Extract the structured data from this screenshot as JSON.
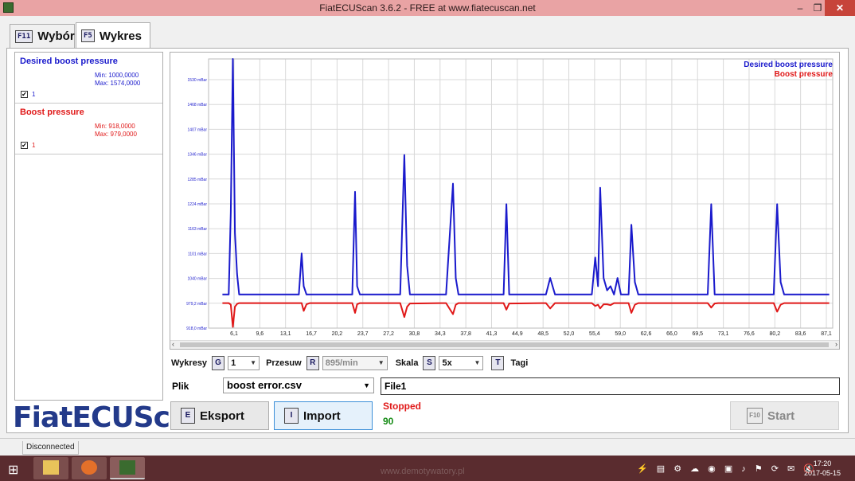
{
  "window": {
    "title": "FiatECUScan 3.6.2 - FREE at www.fiatecuscan.net",
    "minimize": "–",
    "maximize": "❐",
    "close": "✕"
  },
  "tabs": [
    {
      "key": "F11",
      "label": "Wybór"
    },
    {
      "key": "F5",
      "label": "Wykres"
    }
  ],
  "params": [
    {
      "name": "Desired boost pressure",
      "min": "Min: 1000,0000",
      "max": "Max: 1574,0000",
      "checked": "✔",
      "label": "1",
      "color": "#1a1acc"
    },
    {
      "name": "Boost pressure",
      "min": "Min: 918,0000",
      "max": "Max: 979,0000",
      "checked": "✔",
      "label": "1",
      "color": "#e01818"
    }
  ],
  "logo": "FiatECUScan",
  "chart_data": {
    "type": "line",
    "ytick_labels": [
      "1530 mBar",
      "1468 mBar",
      "1407 mBar",
      "1346 mBar",
      "1285 mBar",
      "1224 mBar",
      "1163 mBar",
      "1101 mBar",
      "1040 mBar",
      "979,2 mBar",
      "918,0 mBar"
    ],
    "xtick_labels": [
      "6,1",
      "9,6",
      "13,1",
      "16,7",
      "20,2",
      "23,7",
      "27,2",
      "30,8",
      "34,3",
      "37,8",
      "41,3",
      "44,9",
      "48,5",
      "52,0",
      "55,4",
      "59,0",
      "62,6",
      "66,0",
      "69,5",
      "73,1",
      "76,6",
      "80,2",
      "83,6",
      "87,1"
    ],
    "x": [
      4.6,
      5.5,
      5.8,
      6.1,
      6.4,
      6.7,
      7.0,
      7.5,
      15.6,
      16.0,
      16.3,
      16.7,
      17.2,
      22.9,
      23.3,
      23.7,
      24.0,
      24.4,
      29.5,
      30.2,
      30.8,
      31.2,
      31.6,
      36.1,
      36.8,
      37.8,
      38.2,
      38.6,
      44.6,
      45.1,
      45.5,
      45.9,
      50.6,
      51.2,
      51.8,
      52.5,
      56.8,
      57.3,
      57.8,
      58.3,
      58.7,
      59.0,
      59.5,
      60.0,
      60.5,
      61.0,
      61.5,
      62.0,
      62.7,
      63.1,
      63.5,
      64.0,
      64.5,
      74.0,
      74.5,
      75.0,
      75.5,
      76.0,
      83.5,
      84.0,
      84.5,
      85.0,
      85.5,
      92.0
    ],
    "series": [
      {
        "name": "Desired boost pressure",
        "color": "#1a1acc",
        "values": [
          1000,
          1000,
          1200,
          1574,
          1150,
          1050,
          1000,
          1000,
          1000,
          1100,
          1020,
          1000,
          1000,
          1000,
          1000,
          1250,
          1020,
          1000,
          1000,
          1000,
          1340,
          1070,
          1000,
          1000,
          1000,
          1270,
          1040,
          1000,
          1000,
          1000,
          1220,
          1000,
          1000,
          1000,
          1040,
          1000,
          1000,
          1000,
          1000,
          1090,
          1020,
          1260,
          1040,
          1010,
          1020,
          1000,
          1040,
          1000,
          1000,
          1000,
          1170,
          1030,
          1000,
          1000,
          1000,
          1220,
          1000,
          1000,
          1000,
          1000,
          1220,
          1030,
          1000,
          1000
        ]
      },
      {
        "name": "Boost pressure",
        "color": "#e01818",
        "values": [
          979,
          979,
          975,
          921,
          970,
          977,
          979,
          979,
          979,
          979,
          960,
          976,
          979,
          979,
          979,
          955,
          976,
          979,
          979,
          979,
          945,
          970,
          978,
          979,
          979,
          952,
          975,
          979,
          979,
          979,
          963,
          978,
          979,
          979,
          966,
          979,
          979,
          979,
          979,
          972,
          975,
          966,
          976,
          976,
          974,
          979,
          979,
          979,
          979,
          979,
          955,
          975,
          979,
          979,
          979,
          968,
          978,
          979,
          979,
          979,
          958,
          975,
          979,
          979
        ]
      }
    ],
    "ylim": [
      918,
      1574
    ],
    "grid": true,
    "legend": "top-right",
    "legend_entries": [
      "Desired boost pressure",
      "Boost pressure"
    ]
  },
  "controls": {
    "wykresy_label": "Wykresy",
    "wykresy_key": "G",
    "wykresy_value": "1",
    "przesuw_label": "Przesuw",
    "przesuw_key": "R",
    "przesuw_value": "895/min",
    "skala_label": "Skala",
    "skala_key": "S",
    "skala_value": "5x",
    "tagi_key": "T",
    "tagi_label": "Tagi"
  },
  "file": {
    "label": "Plik",
    "value": "boost error.csv",
    "export_key": "E",
    "export_label": "Eksport",
    "import_key": "I",
    "import_label": "Import"
  },
  "status": {
    "file_name": "File1",
    "state": "Stopped",
    "count": "90",
    "start_key": "F10",
    "start_label": "Start"
  },
  "statusbar": {
    "connection": "Disconnected"
  },
  "taskbar": {
    "watermark": "www.demotywatory.pl",
    "time": "17:20",
    "date": "2017-05-15",
    "tray": "⚡ ▤ ⚙ ☁ ◉ ▣ ♪ ⚑ ⟳ ✉ 🔇"
  }
}
